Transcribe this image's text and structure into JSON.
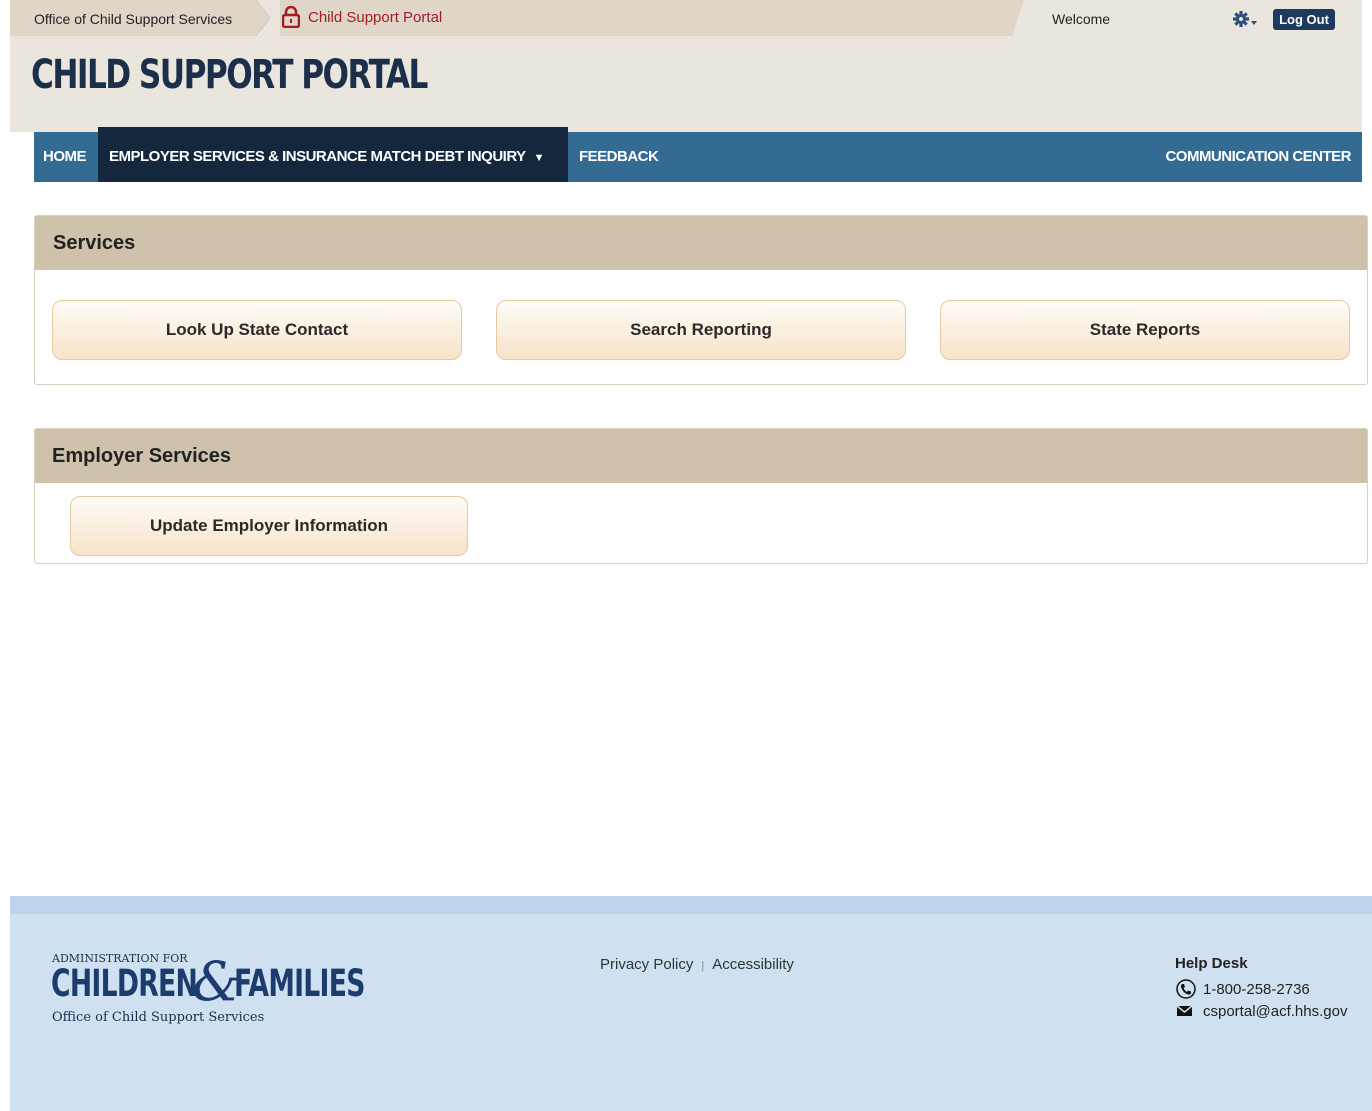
{
  "topbar": {
    "agency": "Office of Child Support Services",
    "portal": "Child Support Portal",
    "welcome": "Welcome",
    "logout": "Log Out"
  },
  "header": {
    "title": "CHILD SUPPORT PORTAL"
  },
  "nav": {
    "home": "HOME",
    "employer": "EMPLOYER SERVICES & INSURANCE MATCH DEBT INQUIRY",
    "feedback": "FEEDBACK",
    "communication": "COMMUNICATION CENTER"
  },
  "services": {
    "title": "Services",
    "buttons": [
      "Look Up State Contact",
      "Search Reporting",
      "State Reports"
    ]
  },
  "employer_services": {
    "title": "Employer Services",
    "buttons": [
      "Update Employer Information"
    ]
  },
  "footer": {
    "logo": {
      "admin": "ADMINISTRATION FOR",
      "children": "CHILDREN",
      "amp": "&",
      "families": "FAMILIES",
      "office": "Office of Child Support Services"
    },
    "privacy": "Privacy Policy",
    "accessibility": "Accessibility",
    "helpdesk": {
      "title": "Help Desk",
      "phone": "1-800-258-2736",
      "email": "csportal@acf.hhs.gov"
    }
  },
  "icons": [
    "lock-icon",
    "gear-icon",
    "phone-icon",
    "email-icon",
    "caret-down-icon"
  ],
  "colors": {
    "nav": "#346b92",
    "nav_active": "#14273d",
    "panel_head": "#cfc2ab",
    "footer": "#cfe1f0",
    "portal_link": "#a31d24"
  }
}
